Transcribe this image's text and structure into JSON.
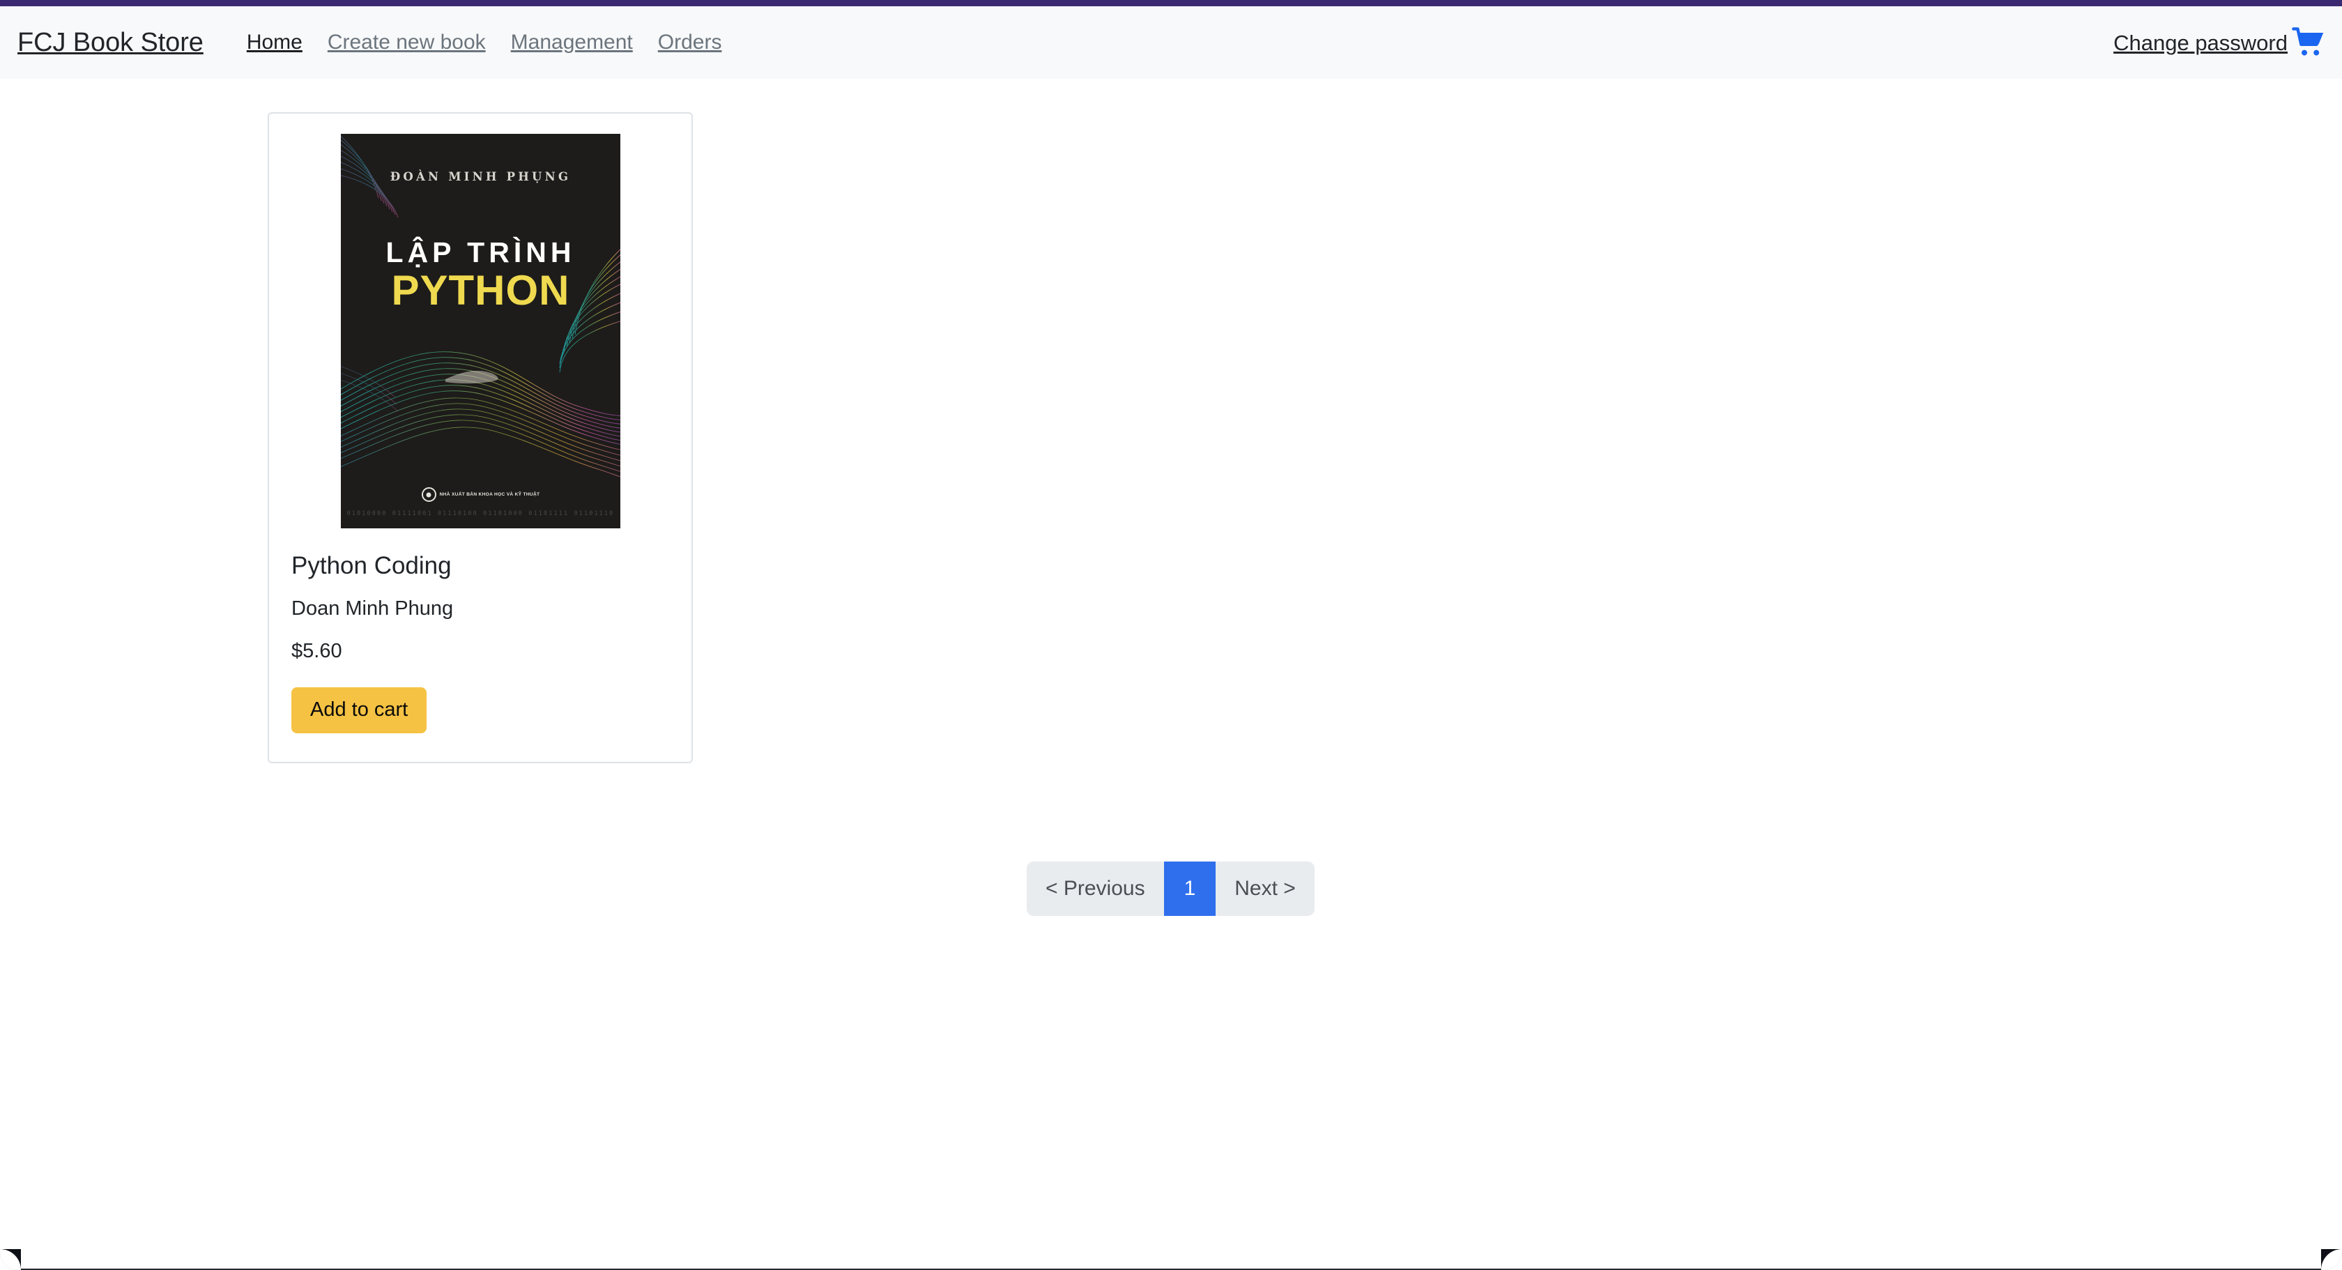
{
  "window": {
    "accent_color": "#3b2a72"
  },
  "navbar": {
    "brand": "FCJ Book Store",
    "links": [
      {
        "label": "Home",
        "active": true
      },
      {
        "label": "Create new book",
        "active": false
      },
      {
        "label": "Management",
        "active": false
      },
      {
        "label": "Orders",
        "active": false
      }
    ],
    "right": {
      "change_password_label": "Change password",
      "cart_icon": "shopping-cart-icon",
      "cart_icon_color": "#1a66f0"
    },
    "background_color": "#f8f9fa",
    "active_link_color": "#1c1f23",
    "inactive_link_color": "#6c757d"
  },
  "books": [
    {
      "title": "Python Coding",
      "author": "Doan Minh Phung",
      "price": "$5.60",
      "add_to_cart_label": "Add to cart",
      "add_to_cart_color": "#f5c243",
      "cover": {
        "author_line": "ĐOÀN MINH PHỤNG",
        "title_line_1": "LẬP TRÌNH",
        "title_line_2": "PYTHON",
        "publisher": "NHÀ XUẤT BẢN KHOA HỌC VÀ KỸ THUẬT",
        "binary_strip": "01010000 01111001 01110100 01101000 01101111 01101110",
        "background_color": "#1d1c1a",
        "title_accent_color": "#efd94f"
      }
    }
  ],
  "pagination": {
    "previous_label": "< Previous",
    "next_label": "Next >",
    "pages": [
      "1"
    ],
    "current_page": "1",
    "active_color": "#2f6fed",
    "track_color": "#e9ecef"
  }
}
